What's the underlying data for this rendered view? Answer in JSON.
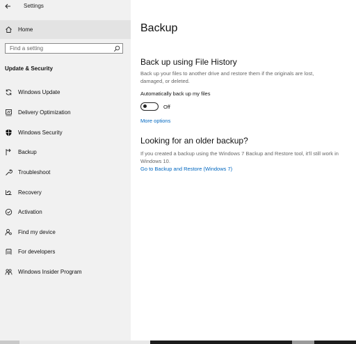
{
  "window": {
    "app_title": "Settings"
  },
  "sidebar": {
    "home_label": "Home",
    "search_placeholder": "Find a setting",
    "section_header": "Update & Security",
    "items": [
      {
        "label": "Windows Update",
        "icon": "sync-icon"
      },
      {
        "label": "Delivery Optimization",
        "icon": "delivery-optimization-icon"
      },
      {
        "label": "Windows Security",
        "icon": "shield-icon"
      },
      {
        "label": "Backup",
        "icon": "backup-arrow-icon"
      },
      {
        "label": "Troubleshoot",
        "icon": "wrench-icon"
      },
      {
        "label": "Recovery",
        "icon": "recovery-icon"
      },
      {
        "label": "Activation",
        "icon": "activation-check-icon"
      },
      {
        "label": "Find my device",
        "icon": "person-location-icon"
      },
      {
        "label": "For developers",
        "icon": "developer-tools-icon"
      },
      {
        "label": "Windows Insider Program",
        "icon": "insider-icon"
      }
    ]
  },
  "main": {
    "page_title": "Backup",
    "file_history": {
      "heading": "Back up using File History",
      "description": "Back up your files to another drive and restore them if the originals are lost, damaged, or deleted.",
      "auto_label": "Automatically back up my files",
      "toggle_state": "Off",
      "more_options_link": "More options"
    },
    "older_backup": {
      "heading": "Looking for an older backup?",
      "description": "If you created a backup using the Windows 7 Backup and Restore tool, it'll still work in Windows 10.",
      "link": "Go to Backup and Restore (Windows 7)"
    }
  },
  "colors": {
    "sidebar_bg": "#f1f1f1",
    "selected_bg": "#e3e3e3",
    "link": "#0067c0"
  }
}
